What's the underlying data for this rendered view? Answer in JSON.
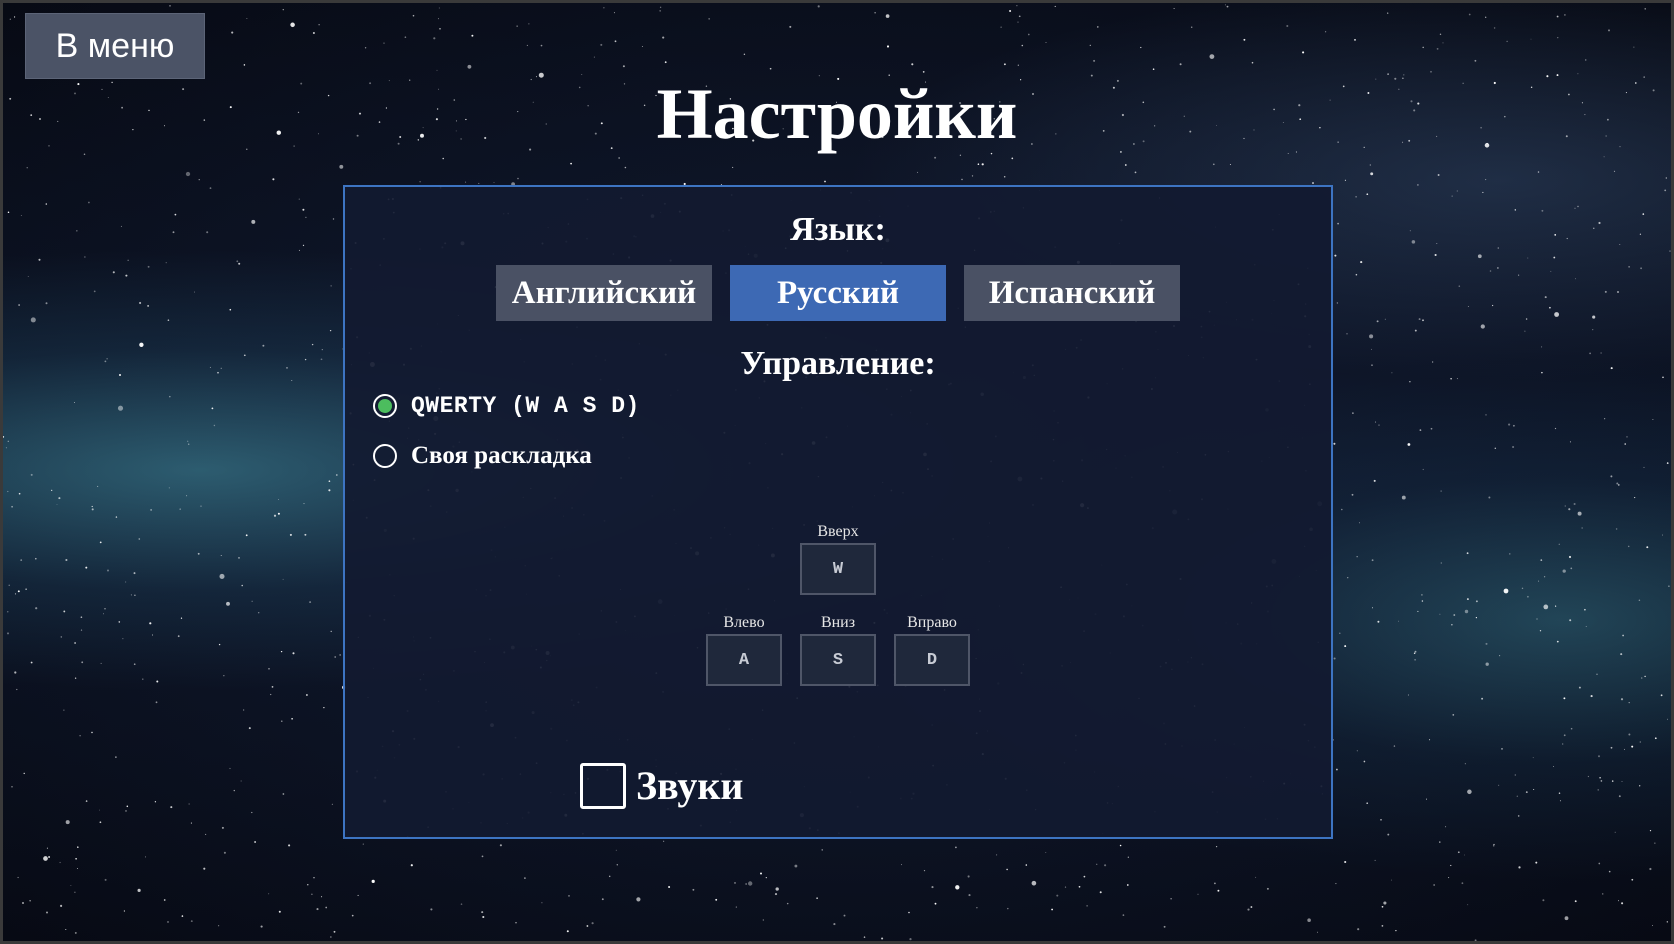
{
  "nav": {
    "menu_label": "В меню"
  },
  "page": {
    "title": "Настройки"
  },
  "language": {
    "label": "Язык:",
    "options": [
      "Английский",
      "Русский",
      "Испанский"
    ],
    "selected": "Русский"
  },
  "controls": {
    "label": "Управление:",
    "options": [
      {
        "label": "QWERTY (W A S D)",
        "selected": true
      },
      {
        "label": "Своя раскладка",
        "selected": false
      }
    ],
    "keys": {
      "up": {
        "caption": "Вверх",
        "key": "W"
      },
      "left": {
        "caption": "Влево",
        "key": "A"
      },
      "down": {
        "caption": "Вниз",
        "key": "S"
      },
      "right": {
        "caption": "Вправо",
        "key": "D"
      }
    }
  },
  "sound": {
    "label": "Звуки",
    "checked": false
  },
  "colors": {
    "accent": "#3d69b4",
    "panel_border": "#3d74c2",
    "radio_selected": "#4cbd5e",
    "button_bg": "#4a5164"
  },
  "icons": {
    "radio_selected": "radio-checked-icon",
    "radio_unselected": "radio-unchecked-icon",
    "checkbox": "checkbox-unchecked-icon"
  }
}
